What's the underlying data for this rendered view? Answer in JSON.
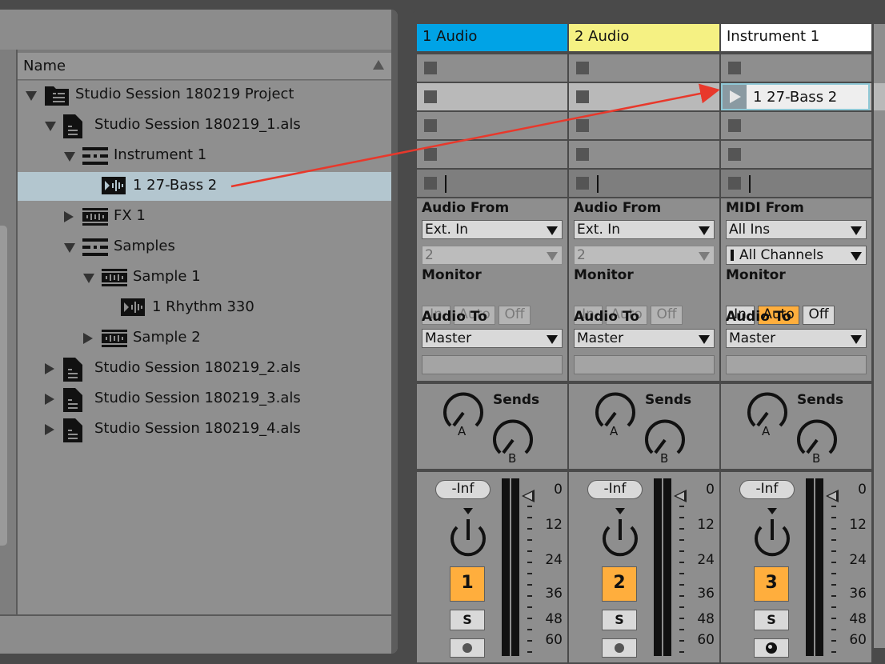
{
  "browser": {
    "column_header": "Name",
    "items": [
      {
        "label": "Studio Session 180219 Project",
        "icon": "project-folder-icon",
        "expander": "down",
        "selected": false
      },
      {
        "label": "Studio Session 180219_1.als",
        "icon": "live-set-icon",
        "expander": "down",
        "selected": false
      },
      {
        "label": "Instrument 1",
        "icon": "instrument-track-icon",
        "expander": "down",
        "selected": false
      },
      {
        "label": "1 27-Bass 2",
        "icon": "clip-icon",
        "expander": "none",
        "selected": true
      },
      {
        "label": "FX 1",
        "icon": "audio-track-icon",
        "expander": "right",
        "selected": false
      },
      {
        "label": "Samples",
        "icon": "instrument-track-icon",
        "expander": "down",
        "selected": false
      },
      {
        "label": "Sample 1",
        "icon": "audio-track-icon",
        "expander": "down",
        "selected": false
      },
      {
        "label": "1 Rhythm 330",
        "icon": "clip-icon",
        "expander": "none",
        "selected": false
      },
      {
        "label": "Sample 2",
        "icon": "audio-track-icon",
        "expander": "right",
        "selected": false
      },
      {
        "label": "Studio Session 180219_2.als",
        "icon": "live-set-icon",
        "expander": "right",
        "selected": false
      },
      {
        "label": "Studio Session 180219_3.als",
        "icon": "live-set-icon",
        "expander": "right",
        "selected": false
      },
      {
        "label": "Studio Session 180219_4.als",
        "icon": "live-set-icon",
        "expander": "right",
        "selected": false
      }
    ]
  },
  "colors": {
    "track1_header": "#00a3e6",
    "track2_header": "#f5f183",
    "track3_header": "#ffffff",
    "arm_orange": "#ffae3d",
    "annotation_arrow": "#e8382b"
  },
  "tracks": [
    {
      "name": "1 Audio",
      "input_label": "Audio From",
      "input_type": "Ext. In",
      "input_channel": "2",
      "monitor_label": "Monitor",
      "monitor": {
        "in": "In",
        "auto": "Auto",
        "off": "Off",
        "active": "none"
      },
      "output_label": "Audio To",
      "output": "Master",
      "sends_label": "Sends",
      "send_a": "A",
      "send_b": "B",
      "volume": "-Inf",
      "track_number": "1",
      "solo": "S",
      "clip": ""
    },
    {
      "name": "2 Audio",
      "input_label": "Audio From",
      "input_type": "Ext. In",
      "input_channel": "2",
      "monitor_label": "Monitor",
      "monitor": {
        "in": "In",
        "auto": "Auto",
        "off": "Off",
        "active": "none"
      },
      "output_label": "Audio To",
      "output": "Master",
      "sends_label": "Sends",
      "send_a": "A",
      "send_b": "B",
      "volume": "-Inf",
      "track_number": "2",
      "solo": "S",
      "clip": ""
    },
    {
      "name": "Instrument 1",
      "input_label": "MIDI From",
      "input_type": "All Ins",
      "input_channel": "All Channels",
      "monitor_label": "Monitor",
      "monitor": {
        "in": "In",
        "auto": "Auto",
        "off": "Off",
        "active": "auto"
      },
      "output_label": "Audio To",
      "output": "Master",
      "sends_label": "Sends",
      "send_a": "A",
      "send_b": "B",
      "volume": "-Inf",
      "track_number": "3",
      "solo": "S",
      "clip": "1 27-Bass 2"
    }
  ],
  "meter_scale": [
    "0",
    "12",
    "24",
    "36",
    "48",
    "60"
  ]
}
